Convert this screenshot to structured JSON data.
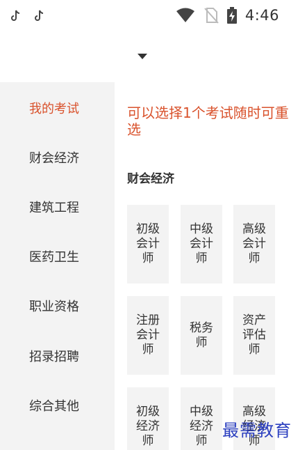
{
  "status_bar": {
    "left_icons": [
      "tiktok-icon",
      "tiktok-icon"
    ],
    "right_icons": [
      "wifi-icon",
      "no-sim-icon",
      "battery-charging-icon"
    ],
    "time": "4:46"
  },
  "header": {
    "dropdown_icon": "caret-down-icon"
  },
  "sidebar": {
    "items": [
      {
        "label": "我的考试",
        "active": true
      },
      {
        "label": "财会经济",
        "active": false
      },
      {
        "label": "建筑工程",
        "active": false
      },
      {
        "label": "医药卫生",
        "active": false
      },
      {
        "label": "职业资格",
        "active": false
      },
      {
        "label": "招录招聘",
        "active": false
      },
      {
        "label": "综合其他",
        "active": false
      }
    ]
  },
  "main": {
    "hint": "可以选择1个考试随时可重选",
    "category_title": "财会经济",
    "exams": [
      {
        "label": "初级会计师"
      },
      {
        "label": "中级会计师"
      },
      {
        "label": "高级会计师"
      },
      {
        "label": "注册会计师"
      },
      {
        "label": "税务师"
      },
      {
        "label": "资产评估师"
      },
      {
        "label": "初级经济师"
      },
      {
        "label": "中级经济师"
      },
      {
        "label": "高级经济师"
      }
    ]
  },
  "watermark": {
    "text": "最需教育"
  },
  "colors": {
    "accent": "#d9522c",
    "sidebar_bg": "#f3f3f3",
    "tile_bg": "#f3f3f3",
    "watermark": "#2b3fbf"
  }
}
